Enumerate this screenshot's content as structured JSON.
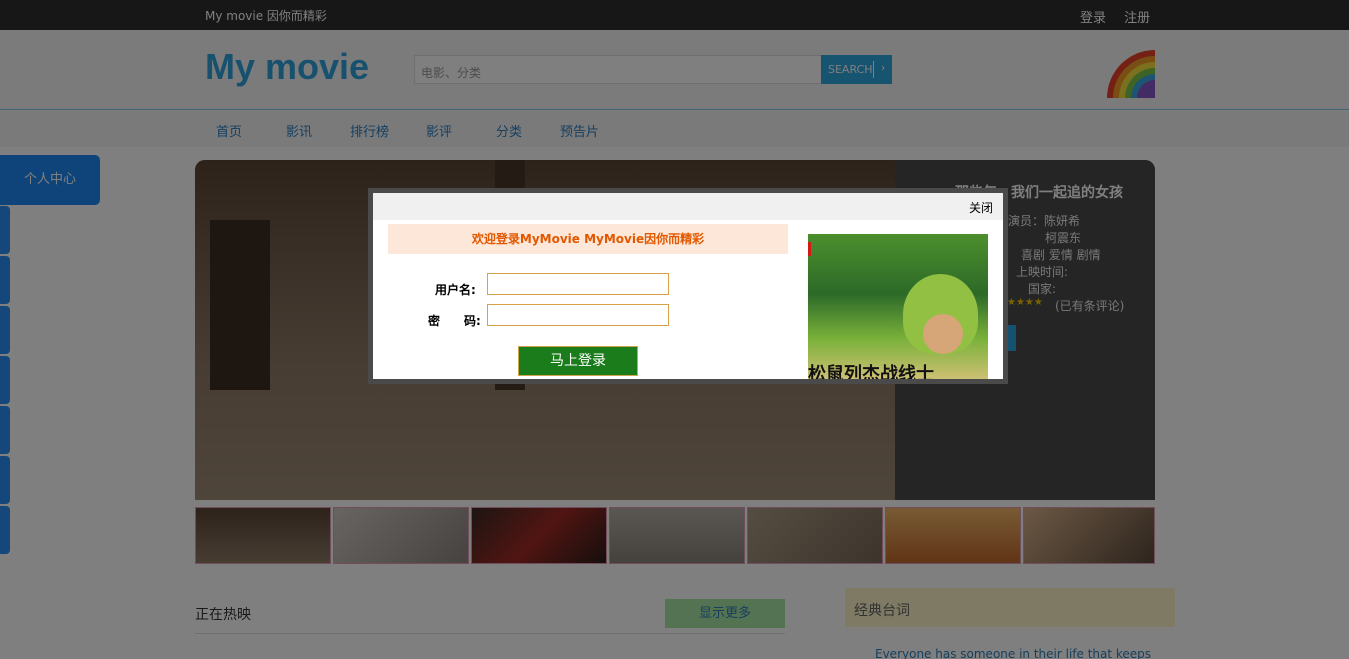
{
  "topbar": {
    "brand": "My movie 因你而精彩",
    "login": "登录",
    "register": "注册"
  },
  "header": {
    "logo": "My movie",
    "search_placeholder": "电影、分类",
    "search_button": "SEARCH",
    "search_chevron": "›"
  },
  "nav": {
    "items": [
      "首页",
      "影讯",
      "排行榜",
      "影评",
      "分类",
      "预告片"
    ]
  },
  "side": {
    "personal_center": "个人中心"
  },
  "banner": {
    "title": "那些年，我们一起追的女孩",
    "actors_label": "演员：陈妍希",
    "actor2": "柯震东",
    "genres": "喜剧  爱情  剧情",
    "release_label": "上映时间:",
    "country_label": "国家:",
    "stars": "★★★★",
    "rating": 4,
    "review_text": "(已有条评论)"
  },
  "section": {
    "now_playing": "正在热映",
    "show_more": "显示更多",
    "classic_lines": "经典台词",
    "quote": "Everyone has someone in their life that keeps"
  },
  "dialog": {
    "close": "关闭",
    "welcome": "欢迎登录MyMovie MyMovie因你而精彩",
    "username_label": "用户名:",
    "password_label": "密　　码:",
    "login_button": "马上登录",
    "poster_title": "松鼠列杰战线士"
  },
  "colors": {
    "accent": "#2fa9df",
    "nav_link": "#2a7fc1",
    "side_blue": "#1e88f5",
    "login_green": "#1a7c1a",
    "welcome_orange": "#e25800"
  }
}
